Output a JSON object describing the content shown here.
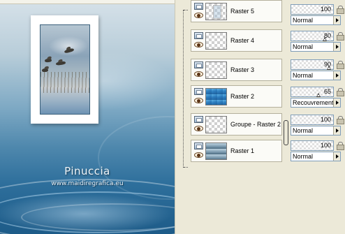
{
  "canvas": {
    "signature_name": "Pinuccia",
    "signature_url": "www.maidiregrafica.eu"
  },
  "layers": [
    {
      "name": "Raster 5",
      "selected": true,
      "thumb": "checker-frame",
      "opacity": "100",
      "opacity_fraction": 1.0,
      "blend_mode": "Normal"
    },
    {
      "name": "Raster 4",
      "selected": false,
      "thumb": "checker",
      "opacity": "80",
      "opacity_fraction": 0.8,
      "blend_mode": "Normal"
    },
    {
      "name": "Raster 3",
      "selected": false,
      "thumb": "checker",
      "opacity": "90",
      "opacity_fraction": 0.9,
      "blend_mode": "Normal"
    },
    {
      "name": "Raster 2",
      "selected": false,
      "thumb": "blue",
      "opacity": "65",
      "opacity_fraction": 0.65,
      "blend_mode": "Recouvrement"
    },
    {
      "name": "Groupe - Raster 2",
      "selected": false,
      "thumb": "checker",
      "opacity": "100",
      "opacity_fraction": 1.0,
      "blend_mode": "Normal"
    },
    {
      "name": "Raster 1",
      "selected": false,
      "thumb": "gradient",
      "opacity": "100",
      "opacity_fraction": 1.0,
      "blend_mode": "Normal"
    }
  ],
  "icons": {
    "layer_type": "raster-layer-icon",
    "visibility": "eye-icon",
    "lock": "lock-icon",
    "dropdown": "dropdown-arrow-icon"
  },
  "colors": {
    "selected_row": "#3163c5",
    "panel_bg": "#ece9d8"
  }
}
